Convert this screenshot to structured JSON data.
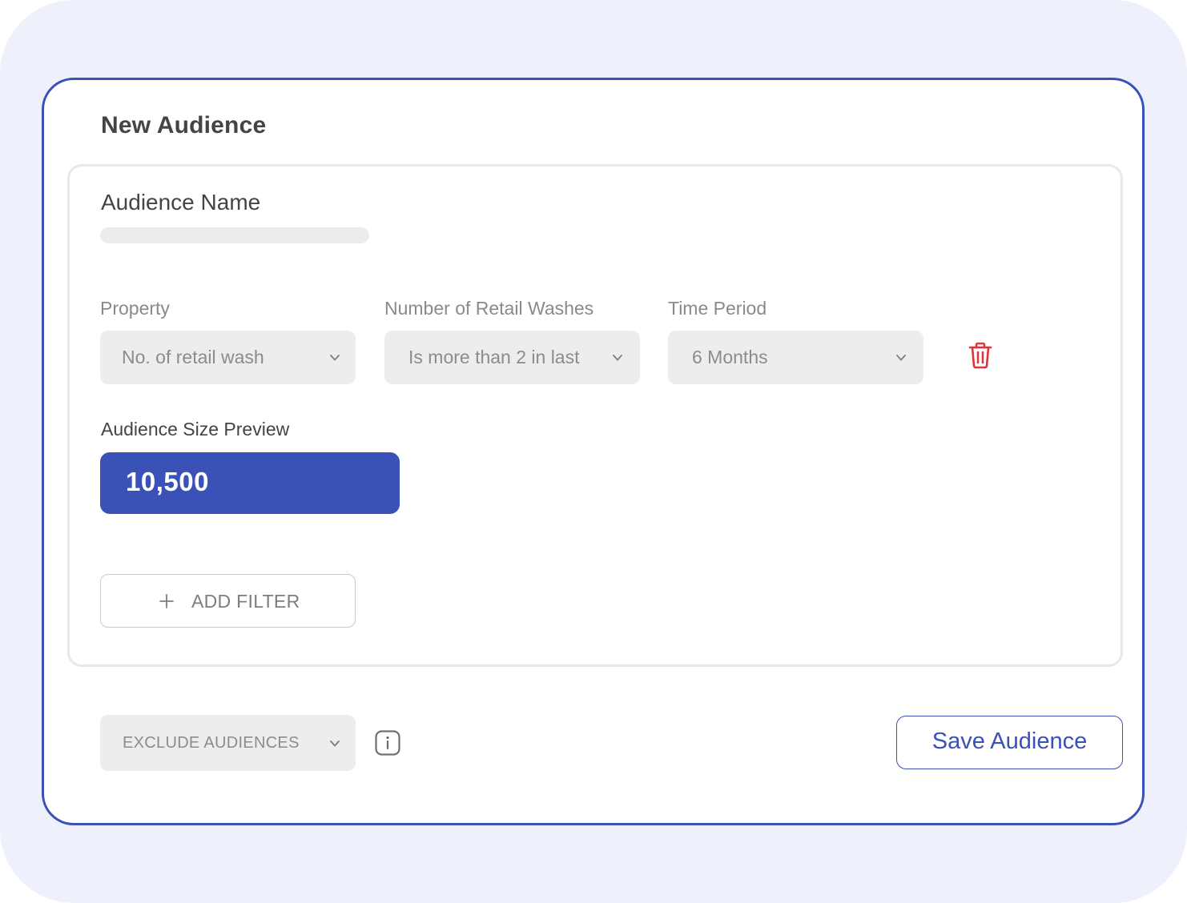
{
  "title": "New Audience",
  "audience_name": {
    "label": "Audience Name",
    "value": ""
  },
  "filters": [
    {
      "property_label": "Property",
      "property_value": "No. of retail wash",
      "condition_label": "Number of Retail Washes",
      "condition_value": "Is more than 2 in last",
      "period_label": "Time Period",
      "period_value": "6 Months"
    }
  ],
  "preview": {
    "label": "Audience Size Preview",
    "value": "10,500"
  },
  "add_filter_label": "ADD FILTER",
  "exclude_label": "EXCLUDE AUDIENCES",
  "save_label": "Save Audience",
  "colors": {
    "primary": "#3a51b8",
    "danger": "#e0353b",
    "backdrop": "#eef1fc"
  },
  "icons": {
    "dropdown": "chevron-down-icon",
    "delete": "trash-icon",
    "add": "plus-icon",
    "info": "info-icon"
  }
}
